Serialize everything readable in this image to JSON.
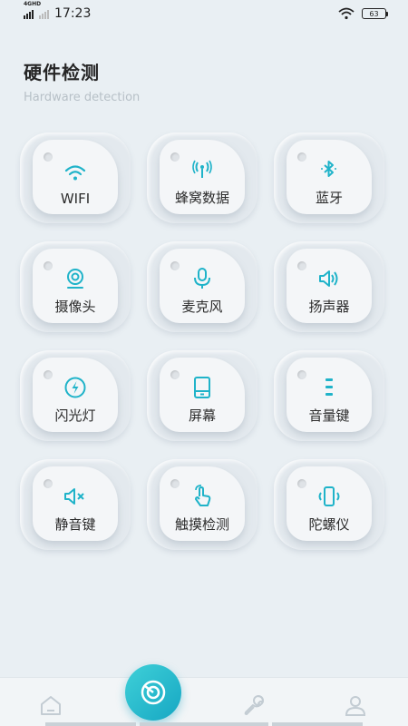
{
  "status_bar": {
    "network_tag": "4GHD",
    "time": "17:23",
    "battery": "63"
  },
  "header": {
    "title": "硬件检测",
    "subtitle": "Hardware detection"
  },
  "tiles": [
    {
      "label": "WIFI",
      "icon": "wifi-icon"
    },
    {
      "label": "蜂窝数据",
      "icon": "cellular-icon"
    },
    {
      "label": "蓝牙",
      "icon": "bluetooth-icon"
    },
    {
      "label": "摄像头",
      "icon": "camera-icon"
    },
    {
      "label": "麦克风",
      "icon": "microphone-icon"
    },
    {
      "label": "扬声器",
      "icon": "speaker-icon"
    },
    {
      "label": "闪光灯",
      "icon": "flash-icon"
    },
    {
      "label": "屏幕",
      "icon": "screen-icon"
    },
    {
      "label": "音量键",
      "icon": "volume-keys-icon"
    },
    {
      "label": "静音键",
      "icon": "mute-icon"
    },
    {
      "label": "触摸检测",
      "icon": "touch-icon"
    },
    {
      "label": "陀螺仪",
      "icon": "gyroscope-icon"
    }
  ],
  "bottom_nav": {
    "items": [
      "home-icon",
      "scan-icon",
      "wrench-icon",
      "profile-icon"
    ]
  },
  "colors": {
    "accent": "#1fb3c9",
    "background": "#e9eff3",
    "tile_inner": "#f4f6f8"
  }
}
